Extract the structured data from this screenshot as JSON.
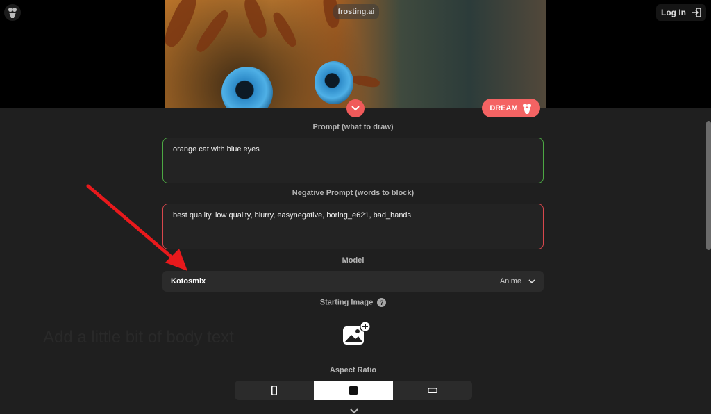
{
  "header": {
    "login_label": "Log In",
    "brand": "frosting.ai",
    "dream_label": "DREAM"
  },
  "prompt": {
    "label": "Prompt (what to draw)",
    "value": "orange cat with blue eyes",
    "border_color": "#4ca843"
  },
  "negative_prompt": {
    "label": "Negative Prompt (words to block)",
    "value": "best quality, low quality, blurry, easynegative, boring_e621, bad_hands",
    "border_color": "#d8474c"
  },
  "model": {
    "label": "Model",
    "name": "Kotosmix",
    "category": "Anime"
  },
  "starting_image": {
    "label": "Starting Image"
  },
  "aspect_ratio": {
    "label": "Aspect Ratio",
    "options": [
      "portrait",
      "square",
      "landscape"
    ],
    "selected": "square"
  },
  "background_text": "Add a little bit of body text",
  "annotation": {
    "arrow_color": "#e8191c"
  },
  "colors": {
    "accent": "#f46363",
    "background": "#1f1f1f"
  }
}
